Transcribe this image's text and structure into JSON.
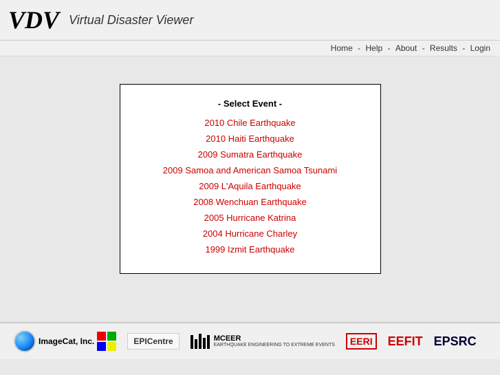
{
  "header": {
    "logo": "VDV",
    "subtitle": "Virtual Disaster Viewer"
  },
  "navbar": {
    "links": [
      {
        "label": "Home",
        "href": "#"
      },
      {
        "label": "Help",
        "href": "#"
      },
      {
        "label": "About",
        "href": "#"
      },
      {
        "label": "Results",
        "href": "#"
      },
      {
        "label": "Login",
        "href": "#"
      }
    ],
    "separator": " - "
  },
  "main": {
    "select_title": "- Select Event -",
    "events": [
      {
        "id": 1,
        "label": "2010 Chile Earthquake"
      },
      {
        "id": 2,
        "label": "2010 Haiti Earthquake"
      },
      {
        "id": 3,
        "label": "2009 Sumatra Earthquake"
      },
      {
        "id": 4,
        "label": "2009 Samoa and American Samoa Tsunami"
      },
      {
        "id": 5,
        "label": "2009 L'Aquila Earthquake"
      },
      {
        "id": 6,
        "label": "2008 Wenchuan Earthquake"
      },
      {
        "id": 7,
        "label": "2005 Hurricane Katrina"
      },
      {
        "id": 8,
        "label": "2004 Hurricane Charley"
      },
      {
        "id": 9,
        "label": "1999 Izmit Earthquake"
      }
    ]
  },
  "footer": {
    "partners": [
      "ImageCat, Inc.",
      "EPICentre",
      "MCEER",
      "EERI",
      "EEFIT",
      "EPSRC"
    ]
  }
}
